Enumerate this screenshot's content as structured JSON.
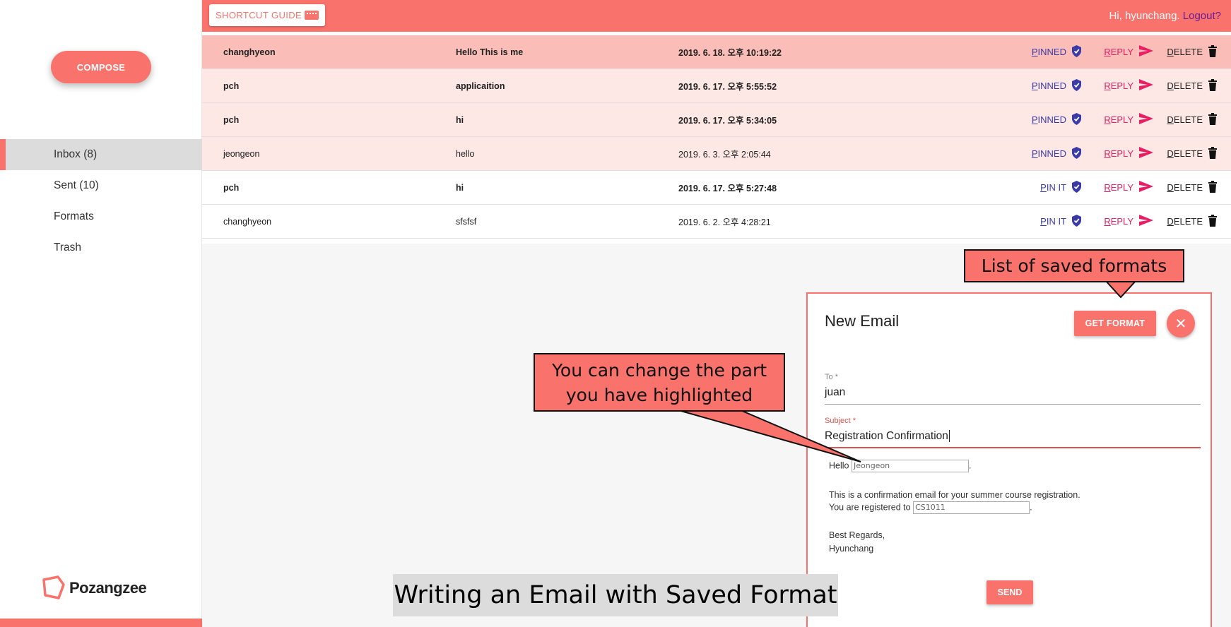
{
  "sidebar": {
    "compose_label": "COMPOSE",
    "nav": [
      {
        "label": "Inbox (8)",
        "active": true
      },
      {
        "label": "Sent (10)",
        "active": false
      },
      {
        "label": "Formats",
        "active": false
      },
      {
        "label": "Trash",
        "active": false
      }
    ],
    "logo_text": "Pozangzee"
  },
  "topbar": {
    "shortcut_label": "SHORTCUT GUIDE",
    "greeting": "Hi, hyunchang.",
    "logout_label": "Logout?"
  },
  "mails": [
    {
      "sender": "changhyeon",
      "subject": "Hello This is me",
      "date": "2019. 6. 18. 오후 10:19:22",
      "pin": "PINNED",
      "reply": "REPLY",
      "delete": "DELETE",
      "state": "highlight",
      "bold": true
    },
    {
      "sender": "pch",
      "subject": "applicaition",
      "date": "2019. 6. 17. 오후 5:55:52",
      "pin": "PINNED",
      "reply": "REPLY",
      "delete": "DELETE",
      "state": "pinned",
      "bold": true
    },
    {
      "sender": "pch",
      "subject": "hi",
      "date": "2019. 6. 17. 오후 5:34:05",
      "pin": "PINNED",
      "reply": "REPLY",
      "delete": "DELETE",
      "state": "pinned",
      "bold": true
    },
    {
      "sender": "jeongeon",
      "subject": "hello",
      "date": "2019. 6. 3. 오후 2:05:44",
      "pin": "PINNED",
      "reply": "REPLY",
      "delete": "DELETE",
      "state": "pinned",
      "bold": false
    },
    {
      "sender": "pch",
      "subject": "hi",
      "date": "2019. 6. 17. 오후 5:27:48",
      "pin": "PIN IT",
      "reply": "REPLY",
      "delete": "DELETE",
      "state": "normal",
      "bold": true
    },
    {
      "sender": "changhyeon",
      "subject": "sfsfsf",
      "date": "2019. 6. 2. 오후 4:28:21",
      "pin": "PIN IT",
      "reply": "REPLY",
      "delete": "DELETE",
      "state": "normal",
      "bold": false
    }
  ],
  "dialog": {
    "title": "New Email",
    "get_format_label": "GET FORMAT",
    "close_symbol": "✕",
    "to_label": "To *",
    "to_value": "juan",
    "subject_label": "Subject *",
    "subject_value": "Registration Confirmation",
    "body": {
      "greeting": "Hello",
      "name_field": "Jeongeon",
      "line1": "This is a confirmation email for your summer course registration.",
      "line2": "You are registered to",
      "course_field": "CS1011",
      "closing1": "Best Regards,",
      "closing2": "Hyunchang"
    },
    "send_label": "SEND"
  },
  "annotations": {
    "formats_callout": "List of saved formats",
    "highlight_callout_line1": "You can change the part",
    "highlight_callout_line2": "you have highlighted",
    "caption": "Writing an Email with Saved Format"
  },
  "colors": {
    "accent": "#f9726b",
    "pinned_row": "#fde8e6",
    "highlight_row": "#fbbdb7",
    "pin_text": "#3a3aa8",
    "reply_text": "#e91e63"
  }
}
